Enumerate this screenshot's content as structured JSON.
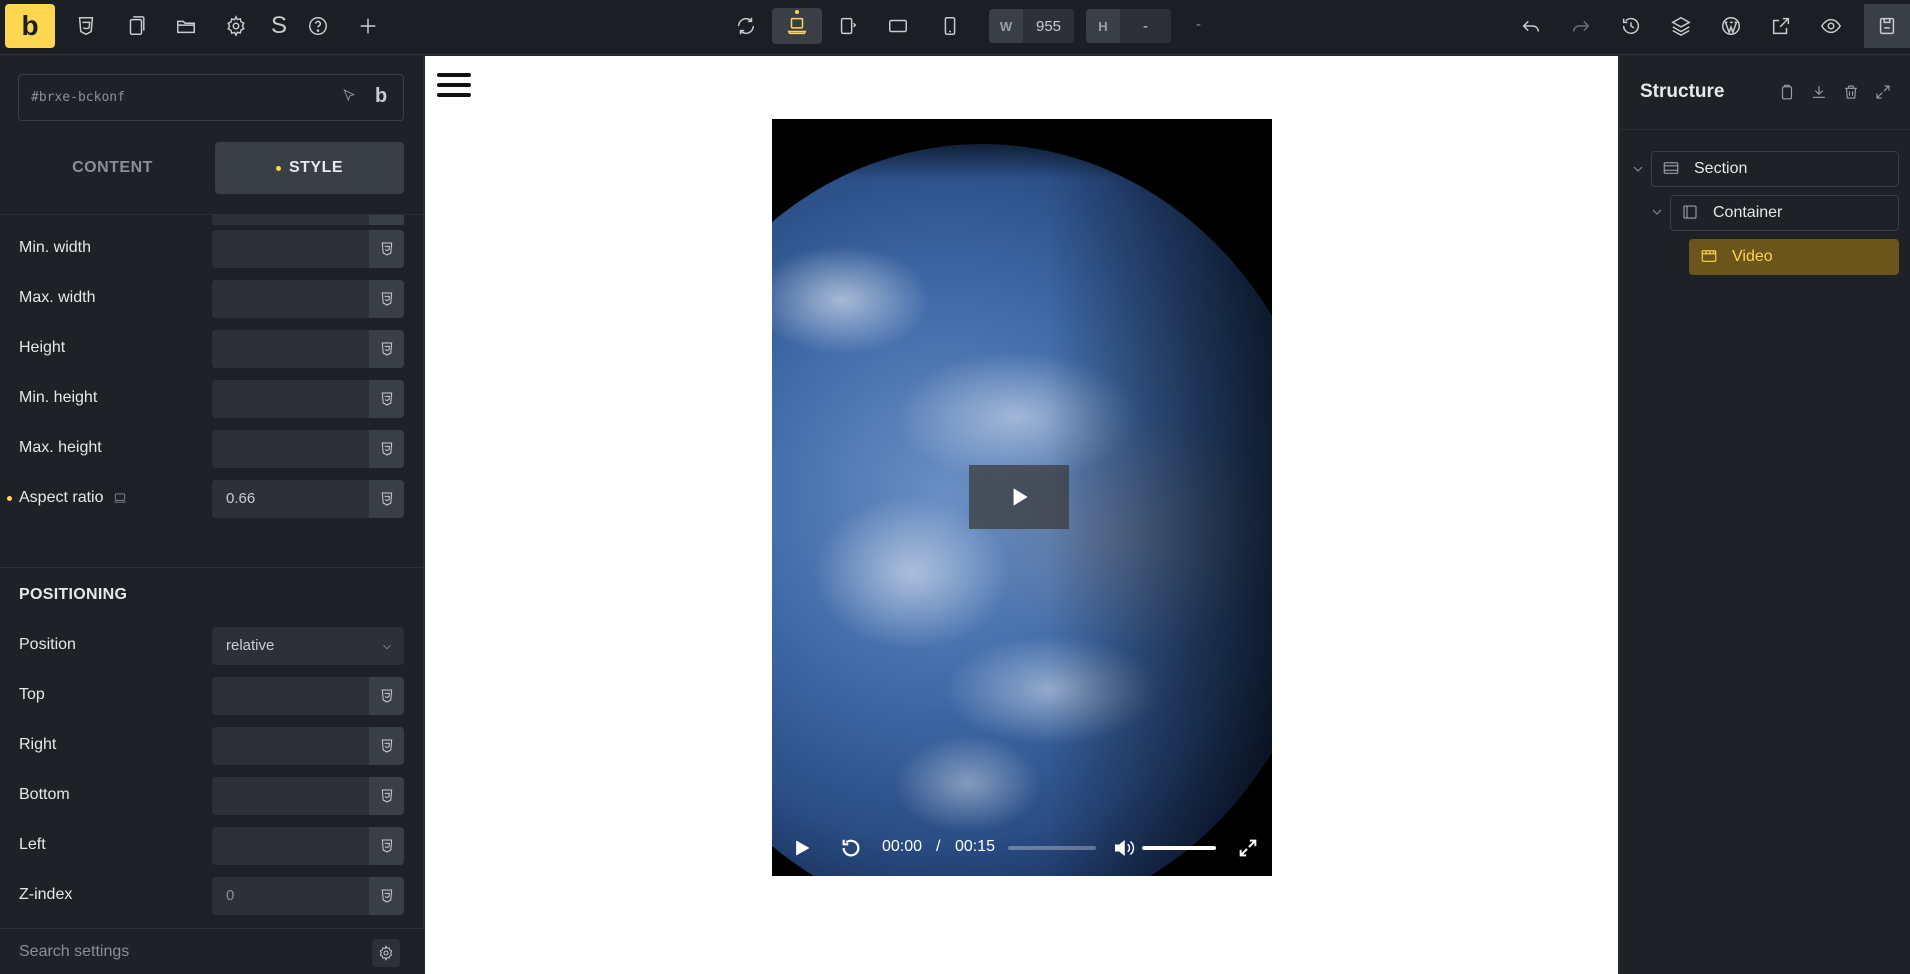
{
  "topbar": {
    "logo": "b",
    "s_label": "S",
    "width_label": "W",
    "width_value": "955",
    "height_label": "H",
    "height_value": "-",
    "dash": "-"
  },
  "left_panel": {
    "selector": "#brxe-bckonf",
    "builder_icon_label": "b",
    "tabs": {
      "content": "CONTENT",
      "style": "STYLE"
    },
    "fields": [
      {
        "label": "Min. width",
        "value": ""
      },
      {
        "label": "Max. width",
        "value": ""
      },
      {
        "label": "Height",
        "value": ""
      },
      {
        "label": "Min. height",
        "value": ""
      },
      {
        "label": "Max. height",
        "value": ""
      },
      {
        "label": "Aspect ratio",
        "value": "0.66"
      }
    ],
    "positioning_title": "POSITIONING",
    "positioning_fields": [
      {
        "label": "Position",
        "value": "relative"
      },
      {
        "label": "Top",
        "value": ""
      },
      {
        "label": "Right",
        "value": ""
      },
      {
        "label": "Bottom",
        "value": ""
      },
      {
        "label": "Left",
        "value": ""
      },
      {
        "label": "Z-index",
        "value": "",
        "placeholder": "0"
      }
    ],
    "search_placeholder": "Search settings"
  },
  "canvas": {
    "video": {
      "current_time": "00:00",
      "separator": "/",
      "duration": "00:15"
    }
  },
  "right_panel": {
    "title": "Structure",
    "tree": [
      {
        "label": "Section",
        "depth": 0,
        "selected": false
      },
      {
        "label": "Container",
        "depth": 1,
        "selected": false
      },
      {
        "label": "Video",
        "depth": 2,
        "selected": true
      }
    ]
  },
  "colors": {
    "accent": "#ffd64f",
    "panel_bg": "#1e2125",
    "topbar_bg": "#1b1e22",
    "selected_row": "#6b551a"
  }
}
